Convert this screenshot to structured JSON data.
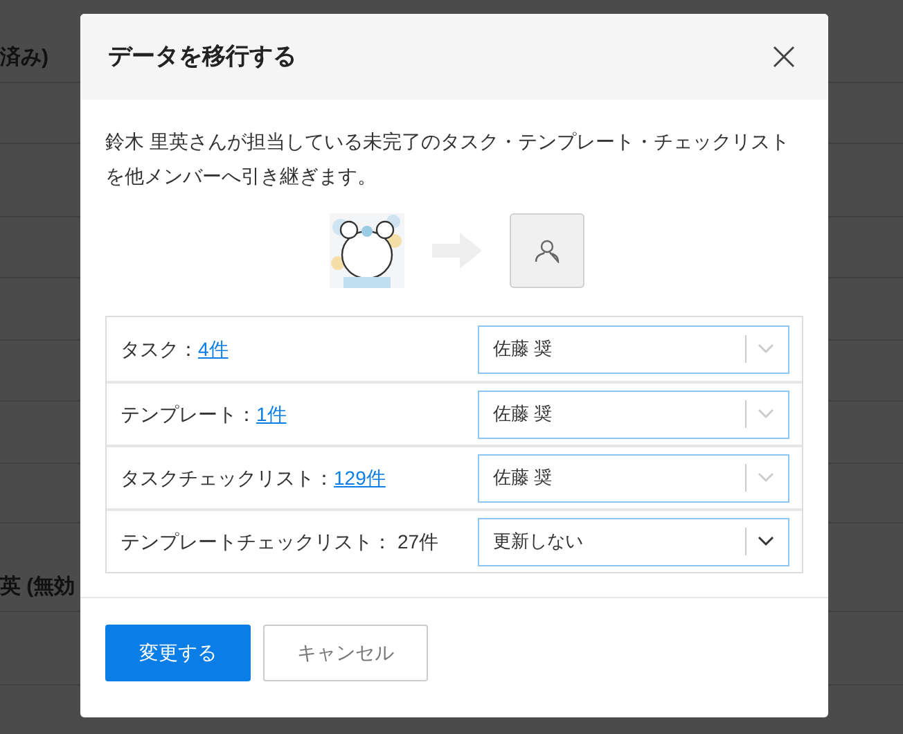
{
  "background": {
    "rows": [
      {
        "text": "済み)"
      },
      {
        "text": ""
      },
      {
        "text": ""
      },
      {
        "text": ""
      },
      {
        "text": ""
      },
      {
        "text": ""
      },
      {
        "text": ""
      },
      {
        "text": ""
      },
      {
        "text": "英 (無効"
      },
      {
        "text": ""
      },
      {
        "text": ""
      }
    ]
  },
  "dialog": {
    "title": "データを移行する",
    "description": "鈴木 里英さんが担当している未完了のタスク・テンプレート・チェックリストを他メンバーへ引き継ぎます。",
    "rows": [
      {
        "label": "タスク：",
        "count": "4件",
        "link": true,
        "assignee": "佐藤 奨",
        "changed": true
      },
      {
        "label": "テンプレート：",
        "count": "1件",
        "link": true,
        "assignee": "佐藤 奨",
        "changed": true
      },
      {
        "label": "タスクチェックリスト：",
        "count": "129件",
        "link": true,
        "assignee": "佐藤 奨",
        "changed": true
      },
      {
        "label": "テンプレートチェックリスト：",
        "count": "27件",
        "link": false,
        "assignee": "更新しない",
        "changed": false
      }
    ],
    "buttons": [
      {
        "label": "変更する",
        "kind": "primary"
      },
      {
        "label": "キャンセル",
        "kind": "secondary"
      }
    ]
  }
}
